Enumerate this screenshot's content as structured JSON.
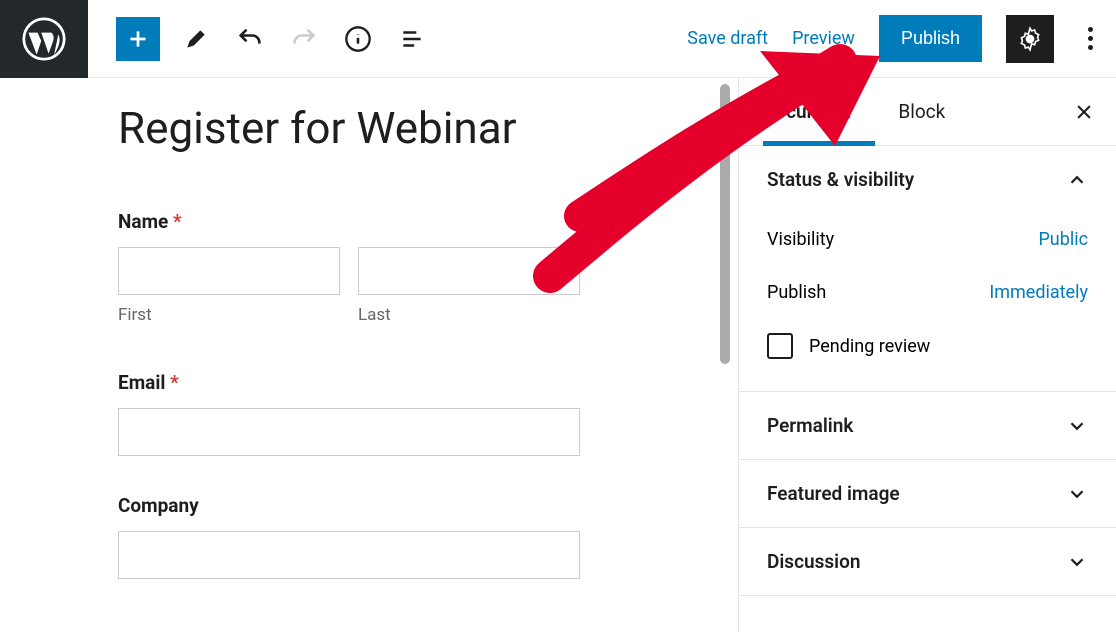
{
  "toolbar": {
    "save_draft": "Save draft",
    "preview": "Preview",
    "publish": "Publish"
  },
  "editor": {
    "title": "Register for Webinar",
    "fields": {
      "name_label": "Name",
      "first_sub": "First",
      "last_sub": "Last",
      "email_label": "Email",
      "company_label": "Company"
    }
  },
  "sidebar": {
    "tabs": {
      "document": "Document",
      "block": "Block"
    },
    "status": {
      "title": "Status & visibility",
      "visibility_label": "Visibility",
      "visibility_value": "Public",
      "publish_label": "Publish",
      "publish_value": "Immediately",
      "pending_review": "Pending review"
    },
    "panels": {
      "permalink": "Permalink",
      "featured_image": "Featured image",
      "discussion": "Discussion"
    }
  }
}
